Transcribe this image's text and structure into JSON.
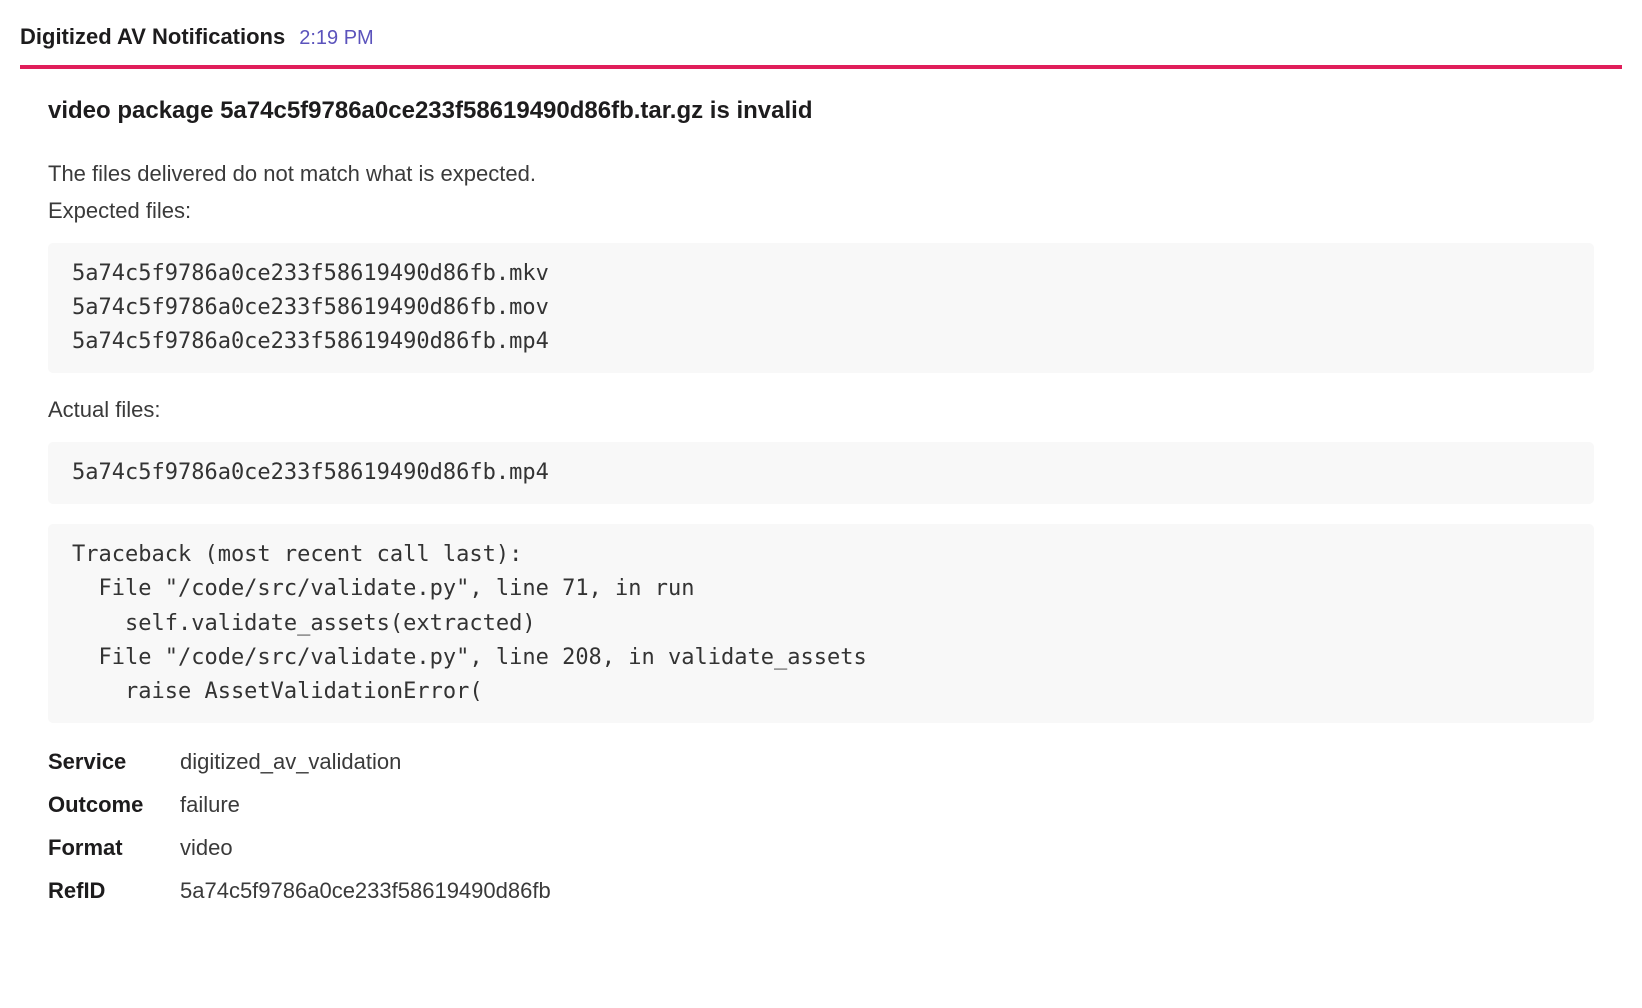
{
  "header": {
    "sender_name": "Digitized AV Notifications",
    "timestamp": "2:19 PM"
  },
  "attachment": {
    "title": "video package 5a74c5f9786a0ce233f58619490d86fb.tar.gz is invalid",
    "intro_line": "The files delivered do not match what is expected.",
    "expected_label": "Expected files:",
    "expected_files_block": "5a74c5f9786a0ce233f58619490d86fb.mkv\n5a74c5f9786a0ce233f58619490d86fb.mov\n5a74c5f9786a0ce233f58619490d86fb.mp4",
    "actual_label": "Actual files:",
    "actual_files_block": "5a74c5f9786a0ce233f58619490d86fb.mp4",
    "traceback_block": "Traceback (most recent call last):\n  File \"/code/src/validate.py\", line 71, in run\n    self.validate_assets(extracted)\n  File \"/code/src/validate.py\", line 208, in validate_assets\n    raise AssetValidationError(",
    "fields": [
      {
        "label": "Service",
        "value": "digitized_av_validation"
      },
      {
        "label": "Outcome",
        "value": "failure"
      },
      {
        "label": "Format",
        "value": "video"
      },
      {
        "label": "RefID",
        "value": "5a74c5f9786a0ce233f58619490d86fb"
      }
    ]
  }
}
